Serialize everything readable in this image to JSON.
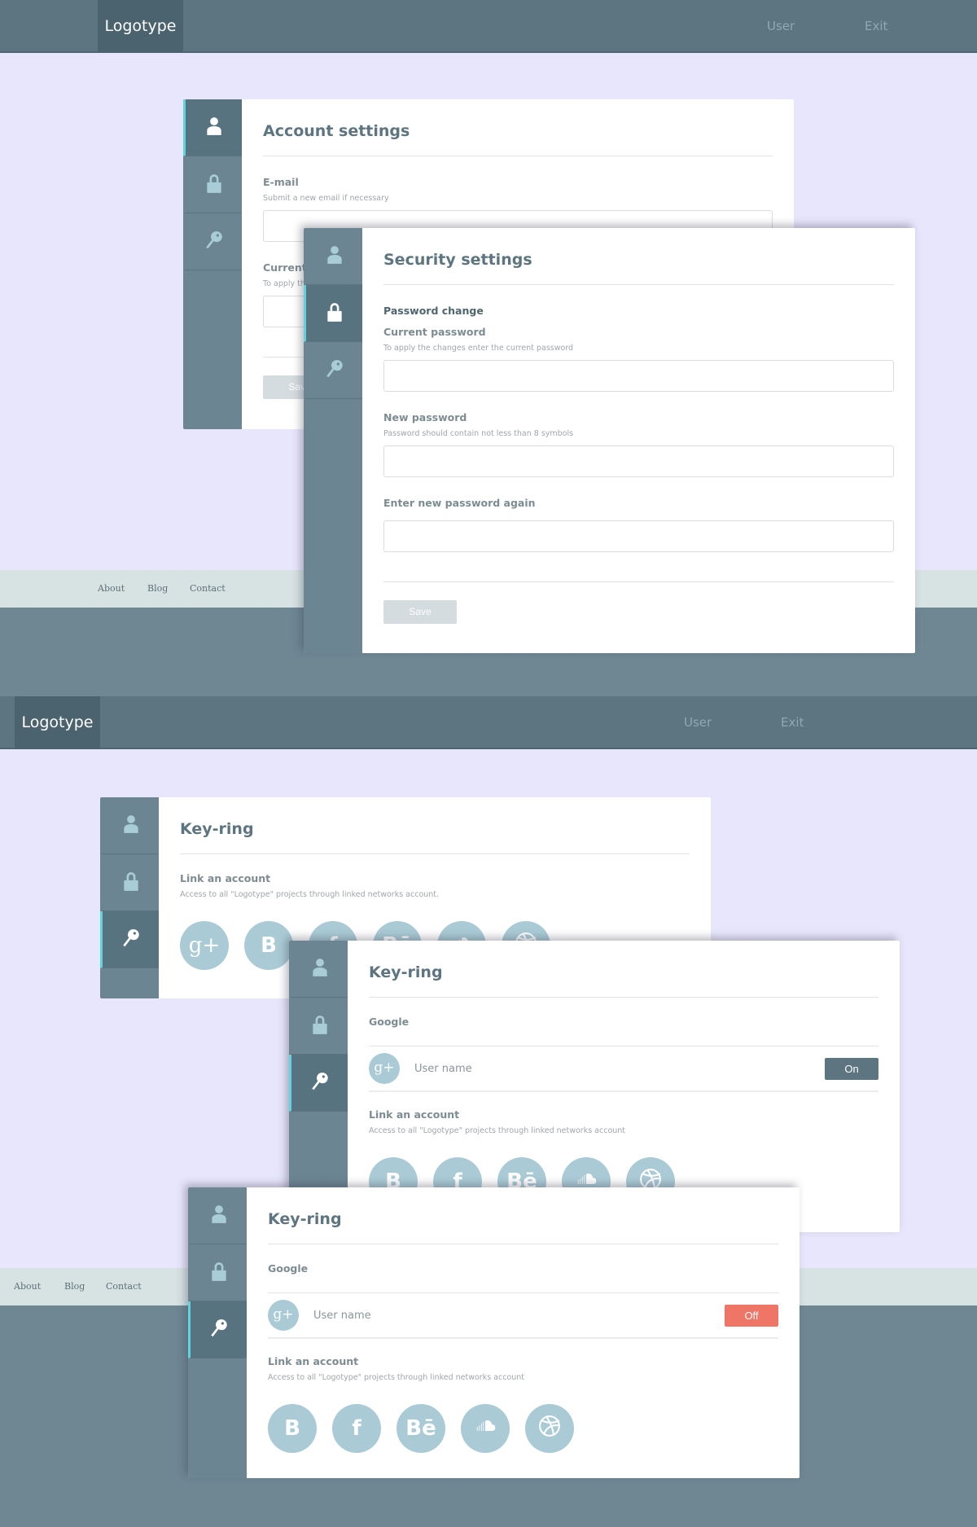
{
  "colors": {
    "header": "#5d7580",
    "accent": "#5fd3e0",
    "icon": "#aacbd6",
    "on": "#5d7580",
    "off": "#ef7566"
  },
  "screens": [
    {
      "logo": "Logotype",
      "nav": [
        "User",
        "Exit"
      ],
      "footer": [
        "About",
        "Blog",
        "Contact"
      ]
    },
    {
      "logo": "Logotype",
      "nav": [
        "User",
        "Exit"
      ],
      "footer": [
        "About",
        "Blog",
        "Contact"
      ]
    }
  ],
  "sidebar_icons": [
    "user-icon",
    "lock-icon",
    "key-icon"
  ],
  "cards": [
    {
      "active": 0,
      "title": "Account settings",
      "blocks": [
        {
          "type": "field",
          "label": "E-mail",
          "hint": "Submit a new email if necessary",
          "value": ""
        },
        {
          "type": "field",
          "label": "Current password",
          "hint": "To apply the changes enter the current password",
          "value": ""
        },
        {
          "type": "hr"
        },
        {
          "type": "save",
          "label": "Save"
        }
      ]
    },
    {
      "active": 1,
      "title": "Security settings",
      "blocks": [
        {
          "type": "heading",
          "label": "Password change"
        },
        {
          "type": "field",
          "label": "Current password",
          "hint": "To apply the changes enter the current password",
          "value": "",
          "tight": true
        },
        {
          "type": "field",
          "label": "New password",
          "hint": "Password should contain not less than 8 symbols",
          "value": ""
        },
        {
          "type": "field",
          "label": "Enter new password again",
          "hint": "",
          "value": ""
        },
        {
          "type": "hr"
        },
        {
          "type": "save",
          "label": "Save"
        }
      ]
    },
    {
      "active": 2,
      "title": "Key-ring",
      "blocks": [
        {
          "type": "link",
          "label": "Link an account",
          "hint": "Access to all \"Logotype\" projects through linked networks account.",
          "socials": [
            "google-plus",
            "blogger",
            "facebook",
            "behance",
            "soundcloud",
            "dribbble"
          ]
        }
      ]
    },
    {
      "active": 2,
      "title": "Key-ring",
      "blocks": [
        {
          "type": "heading",
          "label": "Google",
          "grey": true
        },
        {
          "type": "hr"
        },
        {
          "type": "account",
          "icon": "google-plus",
          "glyph": "g+",
          "username": "User name",
          "toggle": "On",
          "state": "on"
        },
        {
          "type": "link",
          "label": "Link an account",
          "hint": "Access to all \"Logotype\" projects through linked networks account",
          "socials": [
            "blogger",
            "facebook",
            "behance",
            "soundcloud",
            "dribbble"
          ]
        }
      ]
    },
    {
      "active": 2,
      "title": "Key-ring",
      "blocks": [
        {
          "type": "heading",
          "label": "Google",
          "grey": true
        },
        {
          "type": "hr"
        },
        {
          "type": "account",
          "icon": "google-plus",
          "glyph": "g+",
          "username": "User name",
          "toggle": "Off",
          "state": "off"
        },
        {
          "type": "link",
          "label": "Link an account",
          "hint": "Access to all \"Logotype\" projects through linked networks account",
          "socials": [
            "blogger",
            "facebook",
            "behance",
            "soundcloud",
            "dribbble"
          ]
        }
      ]
    }
  ],
  "social_glyphs": {
    "google-plus": "g+",
    "blogger": "B",
    "facebook": "f",
    "behance": "Bē"
  }
}
